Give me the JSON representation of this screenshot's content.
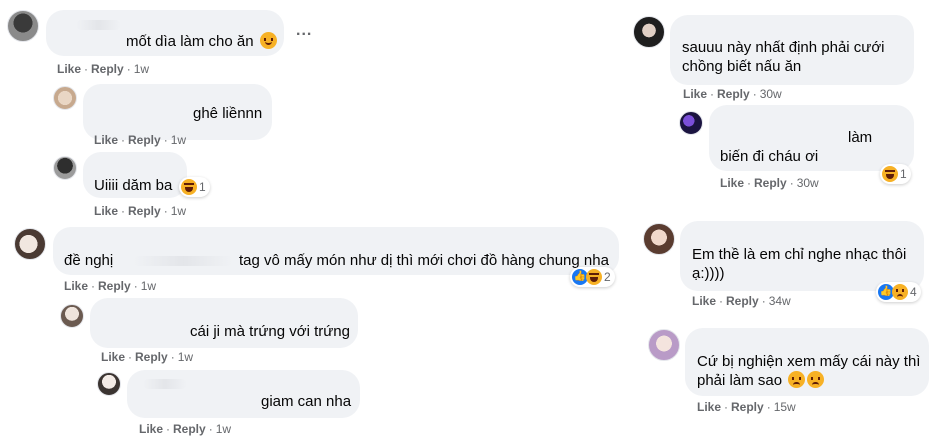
{
  "colors": {
    "bubble": "#f0f2f5",
    "meta_text": "#65676b",
    "like_blue": "#1877f2",
    "emoji_yellow": "#f7b125"
  },
  "actions": {
    "like": "Like",
    "reply": "Reply",
    "dot": "·"
  },
  "more_options": "...",
  "left": [
    {
      "text": "mốt dìa làm cho ăn",
      "emoji": "smile-emoji",
      "time": "1w"
    },
    {
      "text": "ghê liềnnn",
      "time": "1w"
    },
    {
      "text": "Uiiii dăm ba",
      "time": "1w",
      "reaction": {
        "icons": [
          "haha"
        ],
        "count": "1"
      }
    },
    {
      "text1": "đề nghị",
      "text2": "tag vô mấy món như dị thì mới chơi đồ hàng chung nha",
      "time": "1w",
      "reaction": {
        "icons": [
          "like",
          "haha"
        ],
        "count": "2"
      }
    },
    {
      "text": "cái ji mà trứng với trứng",
      "time": "1w"
    },
    {
      "text": "giam can nha",
      "time": "1w"
    }
  ],
  "right": [
    {
      "line1": "sauuu này nhất định phải cưới",
      "line2": "chồng biết nấu ăn",
      "time": "30w"
    },
    {
      "line1": "làm",
      "line2": "biến đi cháu ơi",
      "time": "30w",
      "reaction": {
        "icons": [
          "haha"
        ],
        "count": "1"
      }
    },
    {
      "line1": "Em thề là em chỉ nghe nhạc thôi",
      "line2": "ạ:))))",
      "time": "34w",
      "reaction": {
        "icons": [
          "like",
          "sad"
        ],
        "count": "4"
      }
    },
    {
      "line1": "Cứ bị nghiện xem mấy cái này thì",
      "line2": "phải làm sao",
      "emoji": "sad-emoji",
      "time": "15w"
    }
  ]
}
